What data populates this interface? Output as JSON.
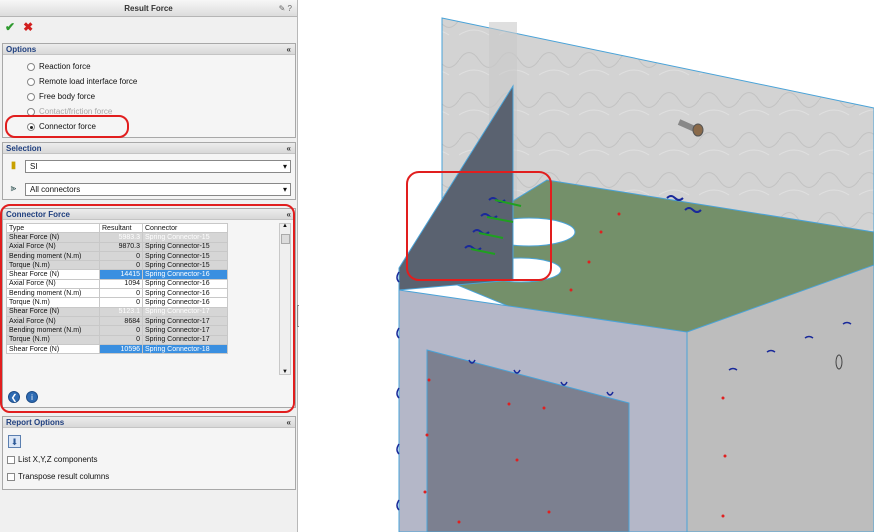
{
  "panel": {
    "title": "Result Force",
    "help_icons": "?",
    "ok_icon": "check-icon",
    "cancel_icon": "x-icon"
  },
  "options": {
    "header": "Options",
    "items": [
      {
        "label": "Reaction force",
        "selected": false,
        "enabled": true
      },
      {
        "label": "Remote load interface force",
        "selected": false,
        "enabled": true
      },
      {
        "label": "Free body force",
        "selected": false,
        "enabled": true
      },
      {
        "label": "Contact/friction force",
        "selected": false,
        "enabled": false
      },
      {
        "label": "Connector force",
        "selected": true,
        "enabled": true
      }
    ]
  },
  "selection": {
    "header": "Selection",
    "unit_value": "SI",
    "connector_value": "All connectors"
  },
  "connector_force": {
    "header": "Connector Force",
    "columns": [
      "Type",
      "Resultant",
      "Connector"
    ],
    "rows": [
      {
        "type": "Shear Force (N)",
        "resultant": "5983.3",
        "connector": "Spring Connector-15"
      },
      {
        "type": "Axial Force (N)",
        "resultant": "9870.3",
        "connector": "Spring Connector-15"
      },
      {
        "type": "Bending moment (N.m)",
        "resultant": "0",
        "connector": "Spring Connector-15"
      },
      {
        "type": "Torque (N.m)",
        "resultant": "0",
        "connector": "Spring Connector-15"
      },
      {
        "type": "Shear Force (N)",
        "resultant": "14415",
        "connector": "Spring Connector-16"
      },
      {
        "type": "Axial Force (N)",
        "resultant": "1094",
        "connector": "Spring Connector-16"
      },
      {
        "type": "Bending moment (N.m)",
        "resultant": "0",
        "connector": "Spring Connector-16"
      },
      {
        "type": "Torque (N.m)",
        "resultant": "0",
        "connector": "Spring Connector-16"
      },
      {
        "type": "Shear Force (N)",
        "resultant": "5123.1",
        "connector": "Spring Connector-17"
      },
      {
        "type": "Axial Force (N)",
        "resultant": "8684",
        "connector": "Spring Connector-17"
      },
      {
        "type": "Bending moment (N.m)",
        "resultant": "0",
        "connector": "Spring Connector-17"
      },
      {
        "type": "Torque (N.m)",
        "resultant": "0",
        "connector": "Spring Connector-17"
      },
      {
        "type": "Shear Force (N)",
        "resultant": "10596",
        "connector": "Spring Connector-18"
      }
    ]
  },
  "report": {
    "header": "Report Options",
    "save_icon": "save-icon",
    "checks": [
      {
        "label": "List X,Y,Z components",
        "checked": false
      },
      {
        "label": "Transpose result columns",
        "checked": false
      }
    ]
  },
  "colors": {
    "highlight": "#e11e1e",
    "selection": "#3a8fe0",
    "section_header_text": "#1f3f7f"
  }
}
